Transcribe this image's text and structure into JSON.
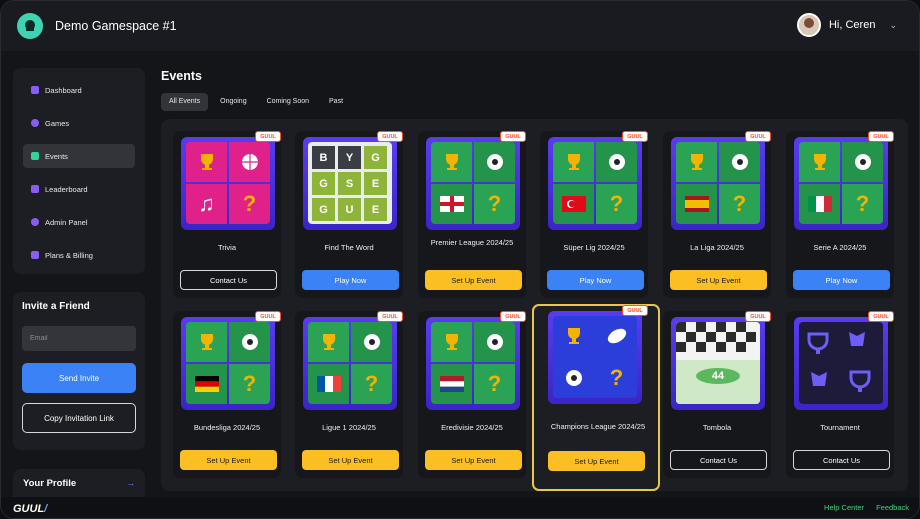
{
  "header": {
    "app_title": "Demo Gamespace #1",
    "greeting": "Hi, Ceren"
  },
  "sidebar": {
    "items": [
      {
        "label": "Dashboard",
        "icon": "grid-icon"
      },
      {
        "label": "Games",
        "icon": "games-icon"
      },
      {
        "label": "Events",
        "icon": "events-icon",
        "active": true
      },
      {
        "label": "Leaderboard",
        "icon": "users-icon"
      },
      {
        "label": "Admin Panel",
        "icon": "admin-icon"
      },
      {
        "label": "Plans & Billing",
        "icon": "billing-icon"
      }
    ]
  },
  "invite": {
    "title": "Invite a Friend",
    "email_placeholder": "Email",
    "send_label": "Send Invite",
    "copy_label": "Copy Invitation Link"
  },
  "profile": {
    "label": "Your Profile"
  },
  "main": {
    "title": "Events",
    "tabs": [
      "All Events",
      "Ongoing",
      "Coming Soon",
      "Past"
    ],
    "badge": "GUUL",
    "cards": [
      {
        "title": "Trivia",
        "button": "Contact Us",
        "style": "outline"
      },
      {
        "title": "Find The Word",
        "button": "Play Now",
        "style": "blue"
      },
      {
        "title": "Premier League 2024/25",
        "button": "Set Up Event",
        "style": "gold"
      },
      {
        "title": "Süper Lig 2024/25",
        "button": "Play Now",
        "style": "blue"
      },
      {
        "title": "La Liga 2024/25",
        "button": "Set Up Event",
        "style": "gold"
      },
      {
        "title": "Serie A 2024/25",
        "button": "Play Now",
        "style": "blue"
      },
      {
        "title": "Bundesliga 2024/25",
        "button": "Set Up Event",
        "style": "gold"
      },
      {
        "title": "Ligue 1 2024/25",
        "button": "Set Up Event",
        "style": "gold"
      },
      {
        "title": "Eredivisie 2024/25",
        "button": "Set Up Event",
        "style": "gold"
      },
      {
        "title": "Champions League 2024/25",
        "button": "Set Up Event",
        "style": "gold",
        "selected": true
      },
      {
        "title": "Tombola",
        "button": "Contact Us",
        "style": "outline"
      },
      {
        "title": "Tournament",
        "button": "Contact Us",
        "style": "outline"
      }
    ],
    "word_grid": [
      "B",
      "Y",
      "G",
      "G",
      "S",
      "E",
      "G",
      "U",
      "E"
    ],
    "tombola_number": "44"
  },
  "footer": {
    "brand": "GUUL",
    "help": "Help Center",
    "feedback": "Feedback"
  },
  "colors": {
    "accent": "#3b82f6",
    "gold": "#fbbf24",
    "purple": "#5a3cf0",
    "selected_border": "#e8c84a"
  }
}
